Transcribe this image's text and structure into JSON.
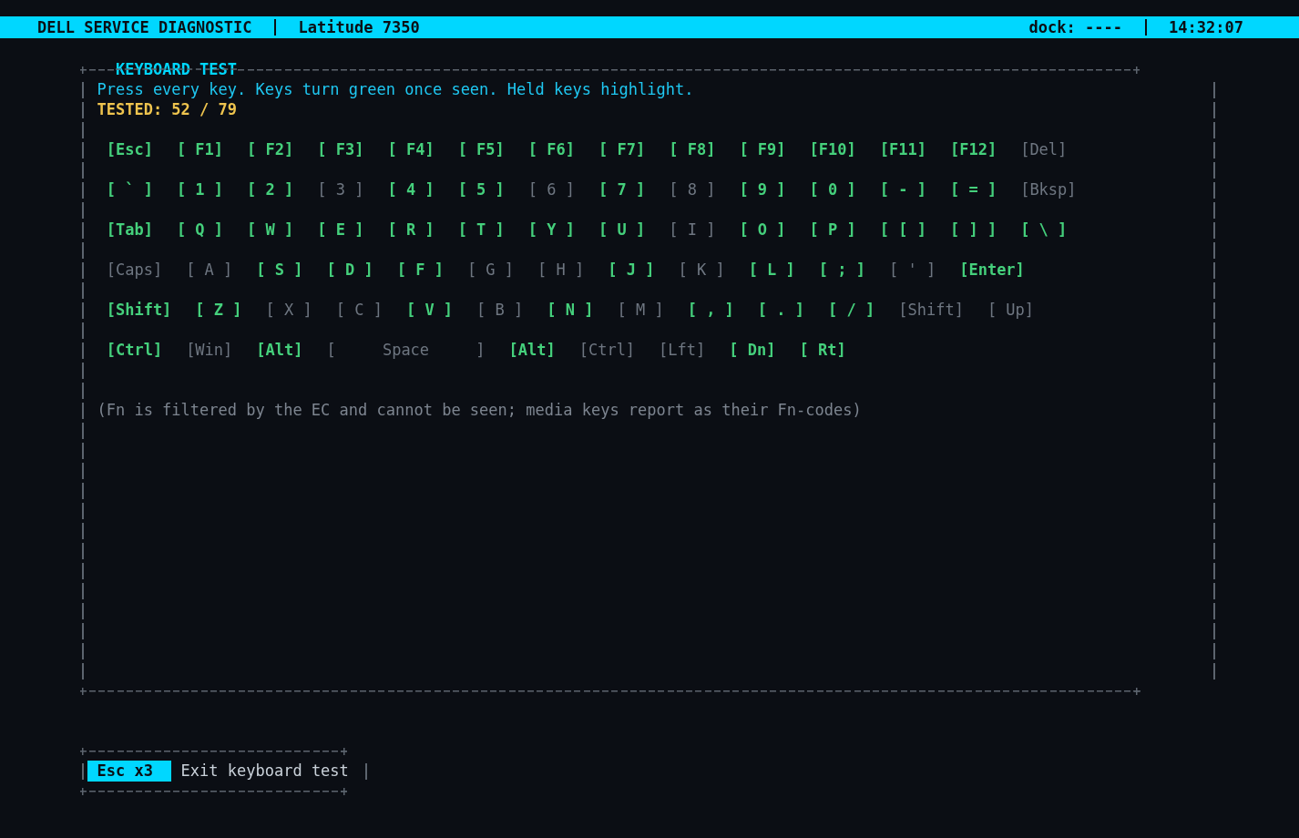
{
  "header": {
    "title": "DELL SERVICE DIAGNOSTIC",
    "model": "Latitude 7350",
    "dock": "dock: ----",
    "time": "14:32:07"
  },
  "panel": {
    "title": "KEYBOARD TEST",
    "instruction": "Press every key. Keys turn green once seen. Held keys highlight.",
    "progress": "TESTED: 52 / 79",
    "key_rows": [
      {
        "keys": [
          {
            "label": "[Esc]",
            "seen": true
          },
          {
            "label": "[ F1]",
            "seen": true
          },
          {
            "label": "[ F2]",
            "seen": true
          },
          {
            "label": "[ F3]",
            "seen": true
          },
          {
            "label": "[ F4]",
            "seen": true
          },
          {
            "label": "[ F5]",
            "seen": true
          },
          {
            "label": "[ F6]",
            "seen": true
          },
          {
            "label": "[ F7]",
            "seen": true
          },
          {
            "label": "[ F8]",
            "seen": true
          },
          {
            "label": "[ F9]",
            "seen": true
          },
          {
            "label": "[F10]",
            "seen": true
          },
          {
            "label": "[F11]",
            "seen": true
          },
          {
            "label": "[F12]",
            "seen": true
          },
          {
            "label": "[Del]",
            "seen": false
          }
        ]
      },
      {
        "keys": [
          {
            "label": "[ ` ]",
            "seen": true
          },
          {
            "label": "[ 1 ]",
            "seen": true
          },
          {
            "label": "[ 2 ]",
            "seen": true
          },
          {
            "label": "[ 3 ]",
            "seen": false
          },
          {
            "label": "[ 4 ]",
            "seen": true
          },
          {
            "label": "[ 5 ]",
            "seen": true
          },
          {
            "label": "[ 6 ]",
            "seen": false
          },
          {
            "label": "[ 7 ]",
            "seen": true
          },
          {
            "label": "[ 8 ]",
            "seen": false
          },
          {
            "label": "[ 9 ]",
            "seen": true
          },
          {
            "label": "[ 0 ]",
            "seen": true
          },
          {
            "label": "[ - ]",
            "seen": true
          },
          {
            "label": "[ = ]",
            "seen": true
          },
          {
            "label": "[Bksp]",
            "seen": false
          }
        ]
      },
      {
        "keys": [
          {
            "label": "[Tab]",
            "seen": true
          },
          {
            "label": "[ Q ]",
            "seen": true
          },
          {
            "label": "[ W ]",
            "seen": true
          },
          {
            "label": "[ E ]",
            "seen": true
          },
          {
            "label": "[ R ]",
            "seen": true
          },
          {
            "label": "[ T ]",
            "seen": true
          },
          {
            "label": "[ Y ]",
            "seen": true
          },
          {
            "label": "[ U ]",
            "seen": true
          },
          {
            "label": "[ I ]",
            "seen": false
          },
          {
            "label": "[ O ]",
            "seen": true
          },
          {
            "label": "[ P ]",
            "seen": true
          },
          {
            "label": "[ [ ]",
            "seen": true
          },
          {
            "label": "[ ] ]",
            "seen": true
          },
          {
            "label": "[ \\ ]",
            "seen": true
          }
        ]
      },
      {
        "keys": [
          {
            "label": "[Caps]",
            "seen": false
          },
          {
            "label": "[ A ]",
            "seen": false
          },
          {
            "label": "[ S ]",
            "seen": true
          },
          {
            "label": "[ D ]",
            "seen": true
          },
          {
            "label": "[ F ]",
            "seen": true
          },
          {
            "label": "[ G ]",
            "seen": false
          },
          {
            "label": "[ H ]",
            "seen": false
          },
          {
            "label": "[ J ]",
            "seen": true
          },
          {
            "label": "[ K ]",
            "seen": false
          },
          {
            "label": "[ L ]",
            "seen": true
          },
          {
            "label": "[ ; ]",
            "seen": true
          },
          {
            "label": "[ ' ]",
            "seen": false
          },
          {
            "label": "[Enter]",
            "seen": true
          }
        ]
      },
      {
        "keys": [
          {
            "label": "[Shift]",
            "seen": true
          },
          {
            "label": "[ Z ]",
            "seen": true
          },
          {
            "label": "[ X ]",
            "seen": false
          },
          {
            "label": "[ C ]",
            "seen": false
          },
          {
            "label": "[ V ]",
            "seen": true
          },
          {
            "label": "[ B ]",
            "seen": false
          },
          {
            "label": "[ N ]",
            "seen": true
          },
          {
            "label": "[ M ]",
            "seen": false
          },
          {
            "label": "[ , ]",
            "seen": true
          },
          {
            "label": "[ . ]",
            "seen": true
          },
          {
            "label": "[ / ]",
            "seen": true
          },
          {
            "label": "[Shift]",
            "seen": false
          },
          {
            "label": "[ Up]",
            "seen": false
          }
        ]
      },
      {
        "keys": [
          {
            "label": "[Ctrl]",
            "seen": true
          },
          {
            "label": "[Win]",
            "seen": false
          },
          {
            "label": "[Alt]",
            "seen": true
          },
          {
            "label": "[     Space     ]",
            "seen": false
          },
          {
            "label": "[Alt]",
            "seen": true
          },
          {
            "label": "[Ctrl]",
            "seen": false
          },
          {
            "label": "[Lft]",
            "seen": false
          },
          {
            "label": "[ Dn]",
            "seen": true
          },
          {
            "label": "[ Rt]",
            "seen": true
          }
        ]
      }
    ],
    "note": "(Fn is filtered by the EC and cannot be seen; media keys report as their Fn-codes)"
  },
  "footer": {
    "hints": [
      {
        "key": "Esc x3",
        "label": "Exit keyboard test"
      }
    ]
  }
}
